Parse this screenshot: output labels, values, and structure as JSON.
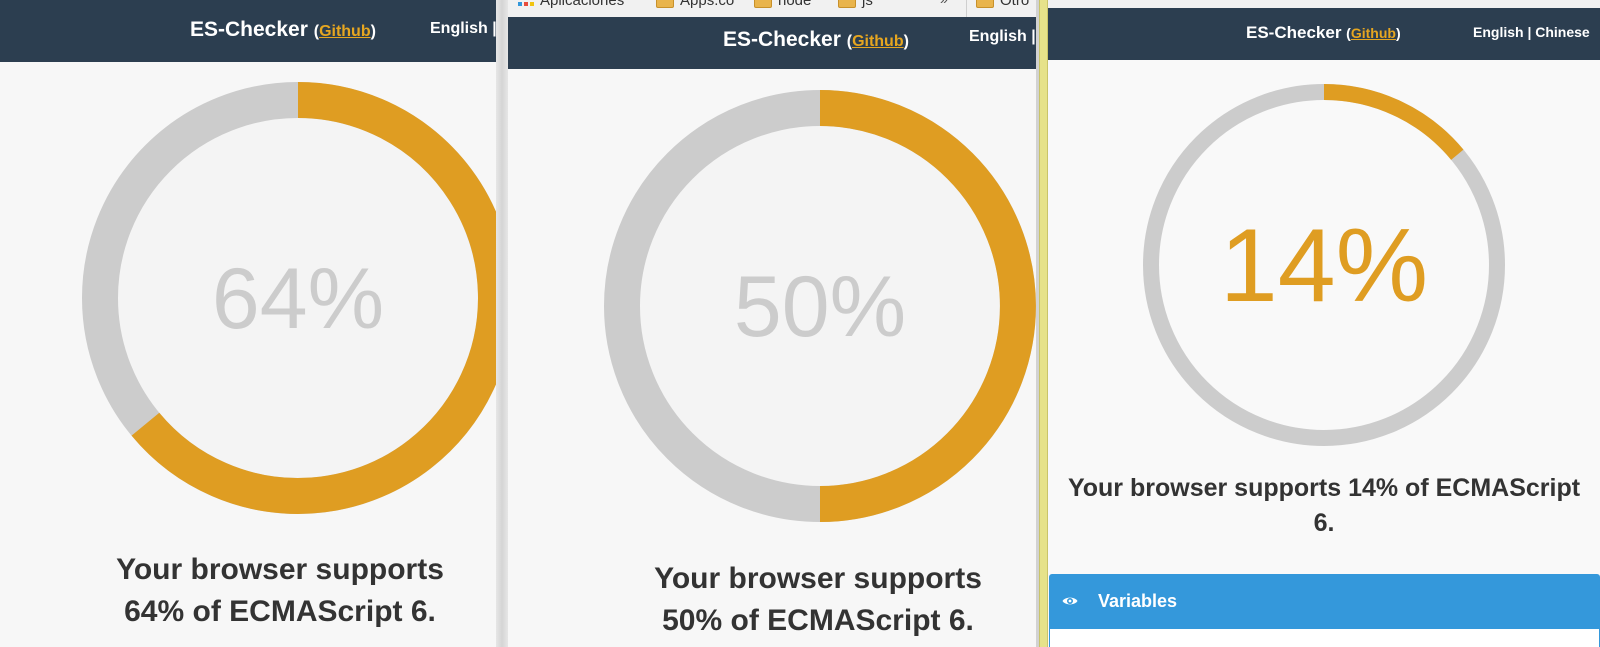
{
  "bookmarks": {
    "items": [
      {
        "label": "Aplicaciones",
        "icon": "apps-icon"
      },
      {
        "label": "Apps.co",
        "icon": "folder-icon"
      },
      {
        "label": "node",
        "icon": "folder-icon"
      },
      {
        "label": "js",
        "icon": "folder-icon"
      },
      {
        "label": "Otro",
        "icon": "folder-icon"
      }
    ],
    "overflow_glyph": "»"
  },
  "panels": [
    {
      "header": {
        "brand": "ES-Checker",
        "link": "Github",
        "language_text": "English | "
      },
      "gauge": {
        "percent": 64,
        "label": "64%",
        "label_color": "#cccccc"
      },
      "support_line1": "Your browser supports",
      "support_line2": "64% of ECMAScript 6."
    },
    {
      "header": {
        "brand": "ES-Checker",
        "link": "Github",
        "language_text": "English | C"
      },
      "gauge": {
        "percent": 50,
        "label": "50%",
        "label_color": "#cccccc"
      },
      "support_line1": "Your browser supports",
      "support_line2": "50% of ECMAScript 6."
    },
    {
      "header": {
        "brand": "ES-Checker",
        "link": "Github",
        "language_text": "English | Chinese"
      },
      "gauge": {
        "percent": 14,
        "label": "14%",
        "label_color": "#df9d22"
      },
      "support_line1": "Your browser supports 14% of ECMAScript",
      "support_line2": "6.",
      "section": {
        "label": "Variables",
        "icon": "eye-icon"
      }
    }
  ],
  "colors": {
    "header_bg": "#2c3e50",
    "accent": "#df9d22",
    "track": "#cccccc",
    "link": "#e6a620",
    "section_bg": "#3498db"
  }
}
